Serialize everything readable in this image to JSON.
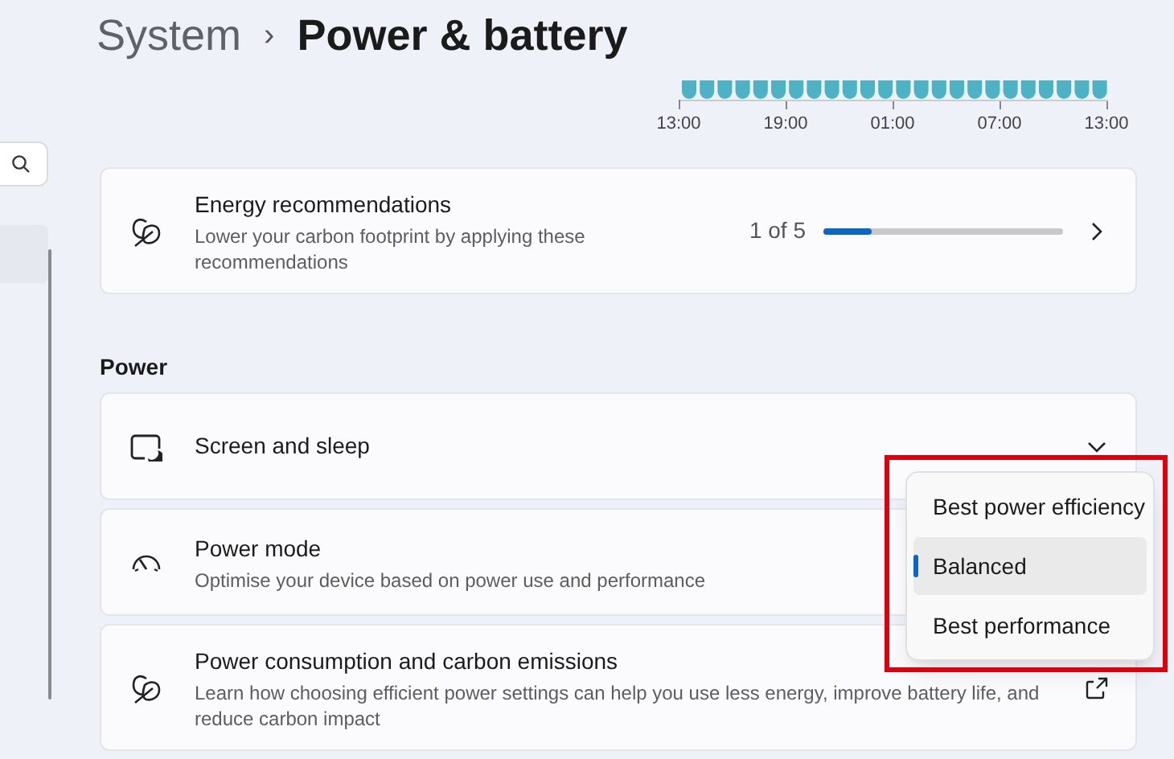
{
  "breadcrumb": {
    "parent": "System",
    "separator": "›",
    "current": "Power & battery"
  },
  "usage_chart": {
    "time_labels": [
      "13:00",
      "19:00",
      "01:00",
      "07:00",
      "13:00"
    ]
  },
  "energy_recommendations": {
    "title": "Energy recommendations",
    "description": "Lower your carbon footprint by applying these recommendations",
    "progress_text": "1 of 5",
    "level": 0.2
  },
  "section_heading": "Power",
  "settings": [
    {
      "kind": "expander",
      "title": "Screen and sleep"
    },
    {
      "kind": "dropdown",
      "title": "Power mode",
      "description": "Optimise your device based on power use and performance"
    },
    {
      "kind": "link",
      "title": "Power consumption and carbon emissions",
      "description": "Learn how choosing efficient power settings can help you use less energy, improve battery life, and reduce carbon impact"
    }
  ],
  "power_mode_menu": {
    "highlighted": true,
    "options": [
      {
        "label": "Best power efficiency",
        "selected": false
      },
      {
        "label": "Balanced",
        "selected": true
      },
      {
        "label": "Best performance",
        "selected": false
      }
    ]
  }
}
